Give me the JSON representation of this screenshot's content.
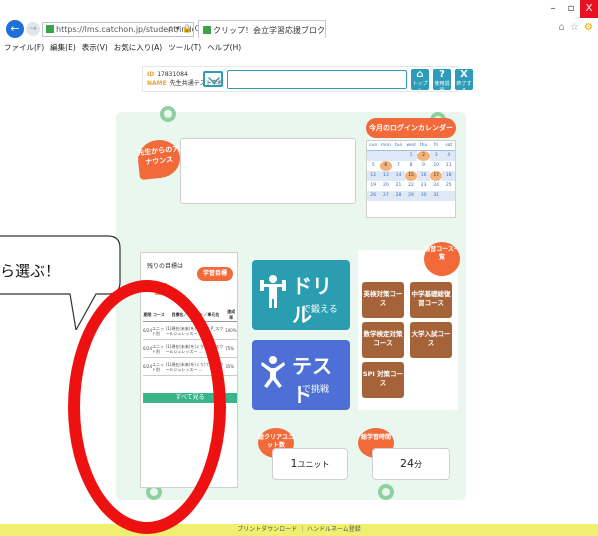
{
  "browser": {
    "address": "https://lms.catchon.jp/student/index.php",
    "address_tools": "ρ ▾ 🔒 C",
    "tab_title": "クリップ！会立学習応援ブロク...",
    "tab_close": "×",
    "back_glyph": "←",
    "forward_glyph": "→",
    "win_min": "–",
    "win_max": "▫",
    "win_close": "X",
    "toolbar_icons": [
      "⌂",
      "☆",
      "⚙"
    ],
    "menu": [
      "ファイル(F)",
      "編集(E)",
      "表示(V)",
      "お気に入り(A)",
      "ツール(T)",
      "ヘルプ(H)"
    ]
  },
  "header": {
    "id_label": "ID",
    "id_value": "17831084",
    "name_label": "NAME",
    "name_value": "先生共通テスト学校",
    "top_label": "トップへ",
    "help_label": "使用説明",
    "exit_label": "終了する",
    "top_glyph": "⌂",
    "help_glyph": "?",
    "exit_glyph": "X"
  },
  "teacher": {
    "tag": "先生からのアナウンス"
  },
  "calendar": {
    "title": "今月のログインカレンダー",
    "days": [
      "sun",
      "mon",
      "tue",
      "wed",
      "thu",
      "fri",
      "sat"
    ],
    "weeks": [
      [
        "",
        "",
        "",
        "1",
        "2",
        "3",
        "4"
      ],
      [
        "5",
        "6",
        "7",
        "8",
        "9",
        "10",
        "11"
      ],
      [
        "12",
        "13",
        "14",
        "15",
        "16",
        "17",
        "18"
      ],
      [
        "19",
        "20",
        "21",
        "22",
        "23",
        "24",
        "25"
      ],
      [
        "26",
        "27",
        "28",
        "29",
        "30",
        "31",
        ""
      ]
    ]
  },
  "remaining": {
    "title": "残りの目標は",
    "goal_badge": "学習目標",
    "columns": [
      "期限",
      "コース",
      "目標名／ユニット／単元名",
      "達成率"
    ],
    "rows": [
      {
        "date": "6/24",
        "course": "ユニット別",
        "name": "(1)現在(未来)を(くり)て P_スクールジュレッスー ...",
        "rate": "100%"
      },
      {
        "date": "6/24",
        "course": "ユニット別",
        "name": "(1)現在(未来)を(くり)て P_スクールジュレッスー ...",
        "rate": "75%"
      },
      {
        "date": "6/24",
        "course": "ユニット別",
        "name": "(1)現在(未来)を(くり)て P_スクールジュレッスー ...",
        "rate": "35%"
      }
    ],
    "see_all": "すべて見る"
  },
  "drill": {
    "main": "ドリル",
    "sub": "で鍛える"
  },
  "test": {
    "main": "テスト",
    "sub": "で挑戦"
  },
  "courses": {
    "title": "通習コース一覧",
    "items": [
      "英検対策コース",
      "中学基礎総復習コース",
      "数学検定対策コース",
      "大学入試コース",
      "SPI 対策コース"
    ]
  },
  "stats": {
    "cleared_tag": "総クリアユニット数",
    "cleared_value": "1",
    "cleared_unit": "ユニット",
    "time_tag": "総学習時間",
    "time_value": "24",
    "time_unit": "分"
  },
  "footer": {
    "text": "プリントダウンロード ｜ ハンドルネーム登録"
  },
  "callout": {
    "text": "ら選ぶ！"
  },
  "colors": {
    "accent": "#2a9db1",
    "orange": "#f26a3a",
    "course": "#a5633a",
    "annotation": "#ee1111",
    "footer": "#f0ef70"
  }
}
